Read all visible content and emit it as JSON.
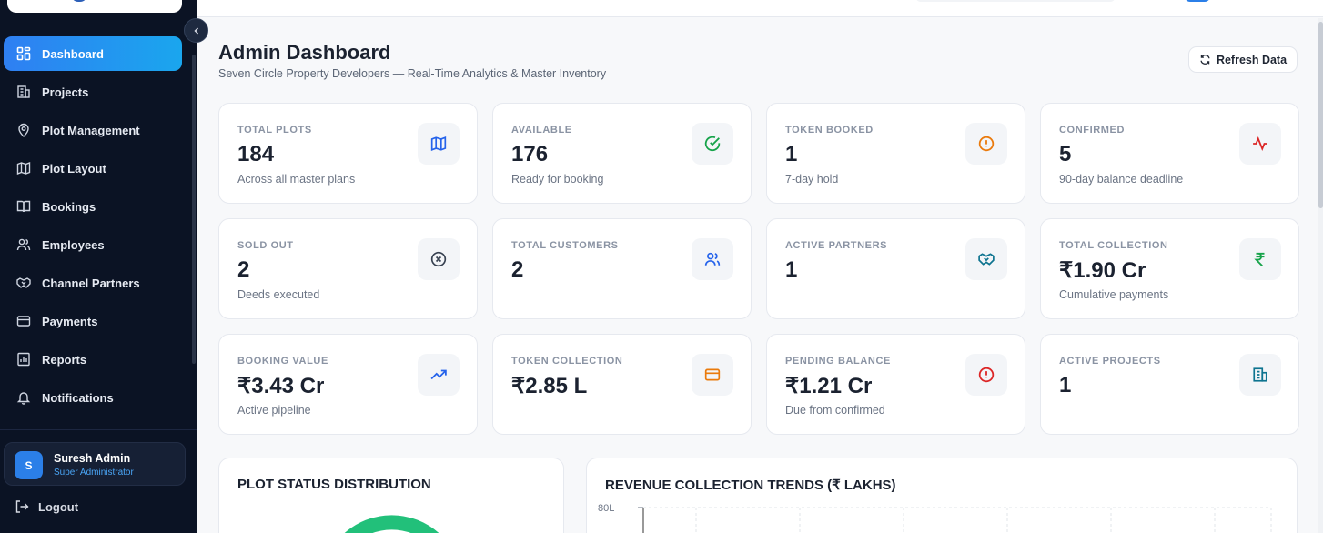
{
  "sidebar": {
    "items": [
      {
        "label": "Dashboard",
        "icon": "dashboard-icon",
        "active": true
      },
      {
        "label": "Projects",
        "icon": "building-icon"
      },
      {
        "label": "Plot Management",
        "icon": "map-pin-icon"
      },
      {
        "label": "Plot Layout",
        "icon": "map-icon"
      },
      {
        "label": "Bookings",
        "icon": "book-icon"
      },
      {
        "label": "Employees",
        "icon": "users-icon"
      },
      {
        "label": "Channel Partners",
        "icon": "handshake-icon"
      },
      {
        "label": "Payments",
        "icon": "credit-card-icon"
      },
      {
        "label": "Reports",
        "icon": "report-icon"
      },
      {
        "label": "Notifications",
        "icon": "bell-icon"
      }
    ],
    "user": {
      "initial": "S",
      "name": "Suresh Admin",
      "role": "Super Administrator"
    },
    "logout": "Logout"
  },
  "header": {
    "title": "Admin Dashboard",
    "subtitle": "Seven Circle Property Developers — Real-Time Analytics & Master Inventory",
    "refresh_label": "Refresh Data"
  },
  "cards": [
    {
      "label": "TOTAL PLOTS",
      "value": "184",
      "desc": "Across all master plans",
      "icon": "map-icon",
      "color": "#2563eb"
    },
    {
      "label": "AVAILABLE",
      "value": "176",
      "desc": "Ready for booking",
      "icon": "check-circle-icon",
      "color": "#16a34a"
    },
    {
      "label": "TOKEN BOOKED",
      "value": "1",
      "desc": "7-day hold",
      "icon": "alert-circle-icon",
      "color": "#ea7a0c"
    },
    {
      "label": "CONFIRMED",
      "value": "5",
      "desc": "90-day balance deadline",
      "icon": "activity-icon",
      "color": "#dc2626"
    },
    {
      "label": "SOLD OUT",
      "value": "2",
      "desc": "Deeds executed",
      "icon": "x-circle-icon",
      "color": "#374151"
    },
    {
      "label": "TOTAL CUSTOMERS",
      "value": "2",
      "desc": "",
      "icon": "users-icon",
      "color": "#2563eb"
    },
    {
      "label": "ACTIVE PARTNERS",
      "value": "1",
      "desc": "",
      "icon": "handshake-icon",
      "color": "#0e7490"
    },
    {
      "label": "TOTAL COLLECTION",
      "value": "₹1.90 Cr",
      "desc": "Cumulative payments",
      "icon": "rupee-icon",
      "color": "#16a34a"
    },
    {
      "label": "BOOKING VALUE",
      "value": "₹3.43 Cr",
      "desc": "Active pipeline",
      "icon": "trending-up-icon",
      "color": "#2563eb"
    },
    {
      "label": "TOKEN COLLECTION",
      "value": "₹2.85 L",
      "desc": "",
      "icon": "credit-card-icon",
      "color": "#ea7a0c"
    },
    {
      "label": "PENDING BALANCE",
      "value": "₹1.21 Cr",
      "desc": "Due from confirmed",
      "icon": "alert-circle-icon",
      "color": "#dc2626"
    },
    {
      "label": "ACTIVE PROJECTS",
      "value": "1",
      "desc": "",
      "icon": "building-icon",
      "color": "#0e7490"
    }
  ],
  "panels": {
    "plot_status_title": "PLOT STATUS DISTRIBUTION",
    "revenue_title": "REVENUE COLLECTION TRENDS (₹ LAKHS)",
    "revenue_first_tick": "80L"
  },
  "colors": {
    "sidebar_bg": "#0b1324",
    "accent": "#2f7ff2",
    "donut_green": "#22c07a"
  }
}
